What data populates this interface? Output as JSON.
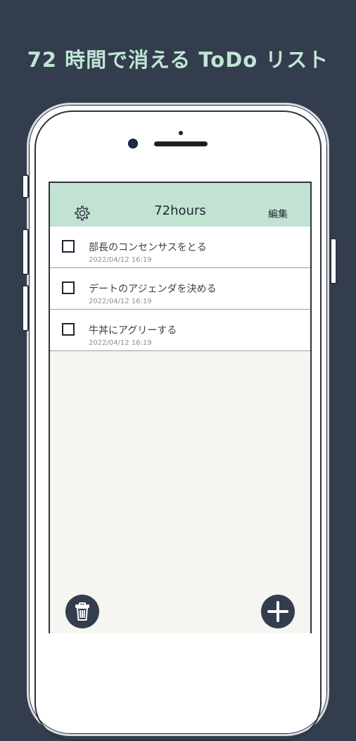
{
  "headline": "72 時間で消える ToDo リスト",
  "nav": {
    "title": "72hours",
    "edit_label": "編集",
    "settings_icon": "gear-icon"
  },
  "todos": [
    {
      "title": "部長のコンセンサスをとる",
      "date": "2022/04/12  16:19",
      "checked": false
    },
    {
      "title": "デートのアジェンダを決める",
      "date": "2022/04/12  16:19",
      "checked": false
    },
    {
      "title": "牛丼にアグリーする",
      "date": "2022/04/12  16:19",
      "checked": false
    }
  ],
  "actions": {
    "delete_icon": "trash-icon",
    "add_icon": "plus-icon"
  },
  "colors": {
    "background": "#333d4d",
    "headline": "#bfe6d3",
    "nav_bar": "#c3e3d2",
    "screen": "#f5f5f1",
    "fab": "#333d4d"
  }
}
